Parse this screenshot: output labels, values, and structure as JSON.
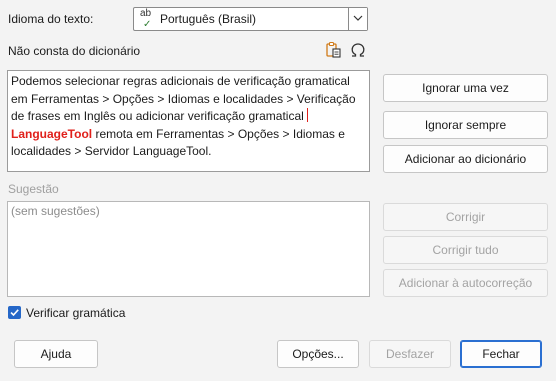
{
  "language": {
    "label": "Idioma do texto:",
    "selected": "Português (Brasil)",
    "icon": "spellcheck-ab-icon"
  },
  "not_in_dictionary_label": "Não consta do dicionário",
  "toolbar_icons": [
    "paste-icon",
    "special-character-omega-icon"
  ],
  "text": {
    "before": "Podemos selecionar regras adicionais de verificação gramatical em Ferramentas > Opções > Idiomas e localidades > Verificação de frases em Inglês ou adicionar verificação gramatical ",
    "highlight": "LanguageTool",
    "after": " remota em Ferramentas > Opções > Idiomas e localidades > Servidor LanguageTool."
  },
  "right_buttons": {
    "ignore_once": "Ignorar uma vez",
    "ignore_always": "Ignorar sempre",
    "add_to_dictionary": "Adicionar ao dicionário"
  },
  "suggestion": {
    "label": "Sugestão",
    "placeholder": "(sem sugestões)"
  },
  "suggestion_buttons": {
    "correct": "Corrigir",
    "correct_all": "Corrigir tudo",
    "add_autocorrect": "Adicionar à autocorreção"
  },
  "check_grammar": {
    "label": "Verificar gramática",
    "checked": true
  },
  "footer": {
    "help": "Ajuda",
    "options": "Opções...",
    "undo": "Desfazer",
    "close": "Fechar"
  },
  "colors": {
    "highlight": "#e0201b",
    "accent": "#2567c8"
  }
}
